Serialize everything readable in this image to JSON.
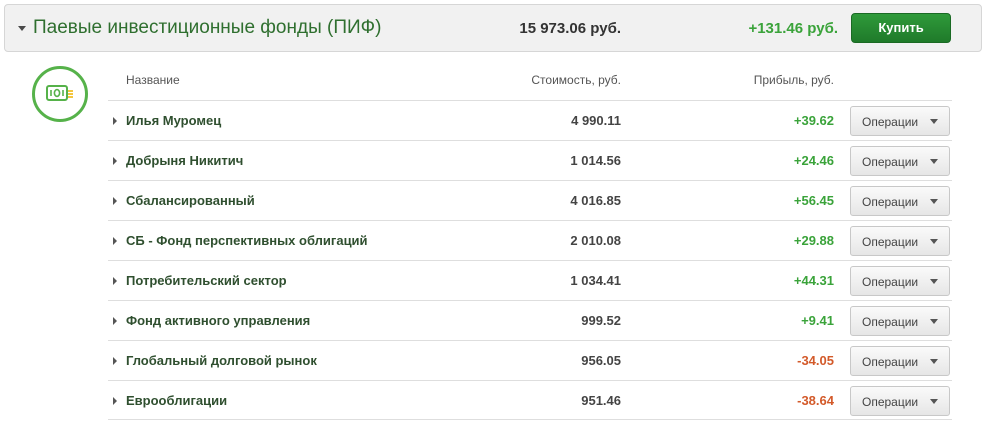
{
  "header": {
    "title": "Паевые инвестиционные фонды (ПИФ)",
    "total": "15 973.06 руб.",
    "profit": "+131.46 руб.",
    "buy_label": "Купить"
  },
  "columns": {
    "name": "Название",
    "cost": "Стоимость, руб.",
    "profit": "Прибыль, руб."
  },
  "operations_label": "Операции",
  "funds": [
    {
      "name": "Илья Муромец",
      "cost": "4 990.11",
      "profit": "+39.62",
      "sign": "pos"
    },
    {
      "name": "Добрыня Никитич",
      "cost": "1 014.56",
      "profit": "+24.46",
      "sign": "pos"
    },
    {
      "name": "Сбалансированный",
      "cost": "4 016.85",
      "profit": "+56.45",
      "sign": "pos"
    },
    {
      "name": "СБ - Фонд перспективных облигаций",
      "cost": "2 010.08",
      "profit": "+29.88",
      "sign": "pos"
    },
    {
      "name": "Потребительский сектор",
      "cost": "1 034.41",
      "profit": "+44.31",
      "sign": "pos"
    },
    {
      "name": "Фонд активного управления",
      "cost": "999.52",
      "profit": "+9.41",
      "sign": "pos"
    },
    {
      "name": "Глобальный долговой рынок",
      "cost": "956.05",
      "profit": "-34.05",
      "sign": "neg"
    },
    {
      "name": "Еврооблигации",
      "cost": "951.46",
      "profit": "-38.64",
      "sign": "neg"
    }
  ],
  "colors": {
    "accent": "#56b24a",
    "title": "#2f6f2f",
    "positive": "#3aa33a",
    "negative": "#d35a2a",
    "buy_button": "#1f7a2a"
  },
  "icons": {
    "header_caret": "caret-down-icon",
    "fund_icon": "money-bill-icon",
    "row_expand": "caret-right-icon",
    "dropdown": "chevron-down-icon"
  }
}
